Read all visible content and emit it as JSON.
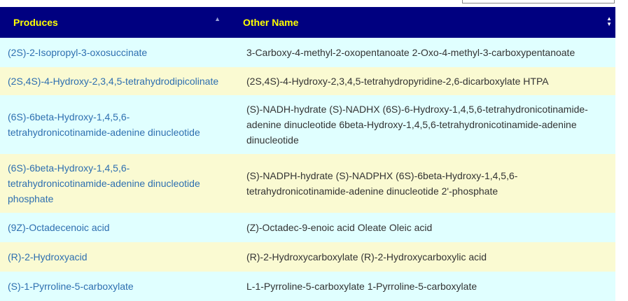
{
  "table": {
    "headers": [
      "Produces",
      "Other Name"
    ],
    "colors": {
      "header_bg": "#000080",
      "header_text": "#ffff00",
      "link": "#2e6fb0",
      "row_odd": "#e0ffff",
      "row_even": "#fafad2"
    },
    "rows": [
      {
        "produces": "(2S)-2-Isopropyl-3-oxosuccinate",
        "other": "3-Carboxy-4-methyl-2-oxopentanoate 2-Oxo-4-methyl-3-carboxypentanoate"
      },
      {
        "produces": "(2S,4S)-4-Hydroxy-2,3,4,5-tetrahydrodipicolinate",
        "other": "(2S,4S)-4-Hydroxy-2,3,4,5-tetrahydropyridine-2,6-dicarboxylate HTPA"
      },
      {
        "produces": "(6S)-6beta-Hydroxy-1,4,5,6-tetrahydronicotinamide-adenine dinucleotide",
        "other": "(S)-NADH-hydrate (S)-NADHX (6S)-6-Hydroxy-1,4,5,6-tetrahydronicotinamide-adenine dinucleotide 6beta-Hydroxy-1,4,5,6-tetrahydronicotinamide-adenine dinucleotide"
      },
      {
        "produces": "(6S)-6beta-Hydroxy-1,4,5,6-tetrahydronicotinamide-adenine dinucleotide phosphate",
        "other": "(S)-NADPH-hydrate (S)-NADPHX (6S)-6beta-Hydroxy-1,4,5,6-tetrahydronicotinamide-adenine dinucleotide 2'-phosphate"
      },
      {
        "produces": "(9Z)-Octadecenoic acid",
        "other": "(Z)-Octadec-9-enoic acid Oleate Oleic acid"
      },
      {
        "produces": "(R)-2-Hydroxyacid",
        "other": "(R)-2-Hydroxycarboxylate (R)-2-Hydroxycarboxylic acid"
      },
      {
        "produces": "(S)-1-Pyrroline-5-carboxylate",
        "other": "L-1-Pyrroline-5-carboxylate 1-Pyrroline-5-carboxylate"
      }
    ]
  }
}
